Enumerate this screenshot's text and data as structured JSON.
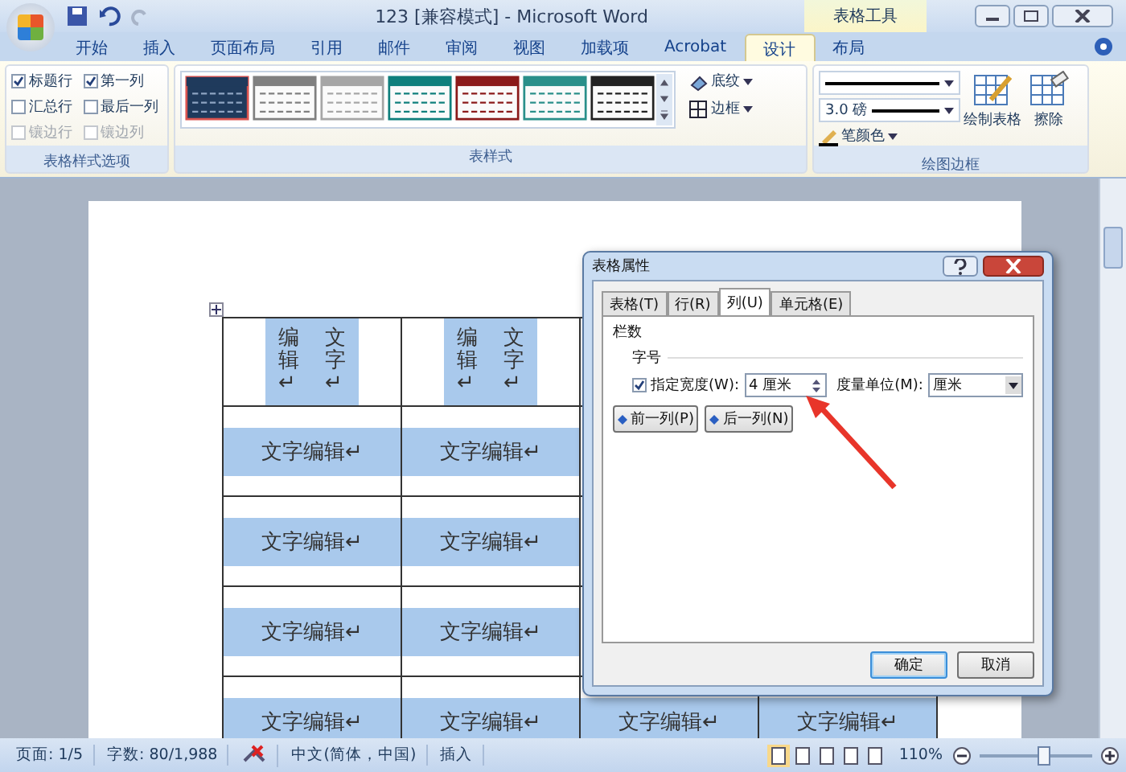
{
  "title_bar": {
    "title": "123 [兼容模式] - Microsoft Word",
    "context_label": "表格工具"
  },
  "ribbon_tabs": [
    {
      "label": "开始",
      "selected": false
    },
    {
      "label": "插入",
      "selected": false
    },
    {
      "label": "页面布局",
      "selected": false
    },
    {
      "label": "引用",
      "selected": false
    },
    {
      "label": "邮件",
      "selected": false
    },
    {
      "label": "审阅",
      "selected": false
    },
    {
      "label": "视图",
      "selected": false
    },
    {
      "label": "加载项",
      "selected": false
    },
    {
      "label": "Acrobat",
      "selected": false
    },
    {
      "label": "设计",
      "selected": true
    },
    {
      "label": "布局",
      "selected": false
    }
  ],
  "style_options": {
    "group_label": "表格样式选项",
    "options": [
      {
        "label": "标题行",
        "checked": true,
        "disabled": false
      },
      {
        "label": "第一列",
        "checked": true,
        "disabled": false
      },
      {
        "label": "汇总行",
        "checked": false,
        "disabled": false
      },
      {
        "label": "最后一列",
        "checked": false,
        "disabled": false
      },
      {
        "label": "镶边行",
        "checked": false,
        "disabled": true
      },
      {
        "label": "镶边列",
        "checked": false,
        "disabled": true
      }
    ]
  },
  "table_styles": {
    "group_label": "表样式",
    "styles": [
      {
        "color": "#1f3a5c",
        "selected": true
      },
      {
        "color": "#808080",
        "selected": false
      },
      {
        "color": "#a6a6a6",
        "selected": false
      },
      {
        "color": "#0f7f7c",
        "selected": false
      },
      {
        "color": "#8b1a1a",
        "selected": false
      },
      {
        "color": "#2a8f8a",
        "selected": false
      },
      {
        "color": "#222222",
        "selected": false
      }
    ],
    "shading": "底纹",
    "borders": "边框"
  },
  "draw_borders": {
    "group_label": "绘图边框",
    "pen_weight": "3.0 磅",
    "pen_color": "笔颜色",
    "draw_table": "绘制表格",
    "eraser": "擦除"
  },
  "document_table": {
    "header_row": [
      {
        "lines": [
          "编辑↵",
          "文字↵"
        ]
      },
      {
        "lines": [
          "编辑↵",
          "文字↵"
        ]
      }
    ],
    "rows": [
      [
        "文字编辑↵",
        "文字编辑↵"
      ],
      [
        "文字编辑↵",
        "文字编辑↵"
      ],
      [
        "文字编辑↵",
        "文字编辑↵"
      ],
      [
        "文字编辑↵",
        "文字编辑↵",
        "文字编辑↵",
        "文字编辑↵"
      ]
    ]
  },
  "dialog": {
    "title": "表格属性",
    "tabs": [
      {
        "label": "表格(T)",
        "selected": false
      },
      {
        "label": "行(R)",
        "selected": false
      },
      {
        "label": "列(U)",
        "selected": true
      },
      {
        "label": "单元格(E)",
        "selected": false
      }
    ],
    "section": "栏数",
    "subsection": "字号",
    "width_label": "指定宽度(W):",
    "width_checked": true,
    "width_value": "4 厘米",
    "unit_label": "度量单位(M):",
    "unit_value": "厘米",
    "prev": "前一列(P)",
    "next": "后一列(N)",
    "ok": "确定",
    "cancel": "取消"
  },
  "status_bar": {
    "page": "页面: 1/5",
    "words": "字数: 80/1,988",
    "language": "中文(简体，中国)",
    "mode": "插入",
    "views": [
      {
        "selected": true
      },
      {
        "selected": false
      },
      {
        "selected": false
      },
      {
        "selected": false
      },
      {
        "selected": false
      }
    ],
    "zoom": "110%",
    "zoom_slider": {
      "level": 0.57
    }
  }
}
